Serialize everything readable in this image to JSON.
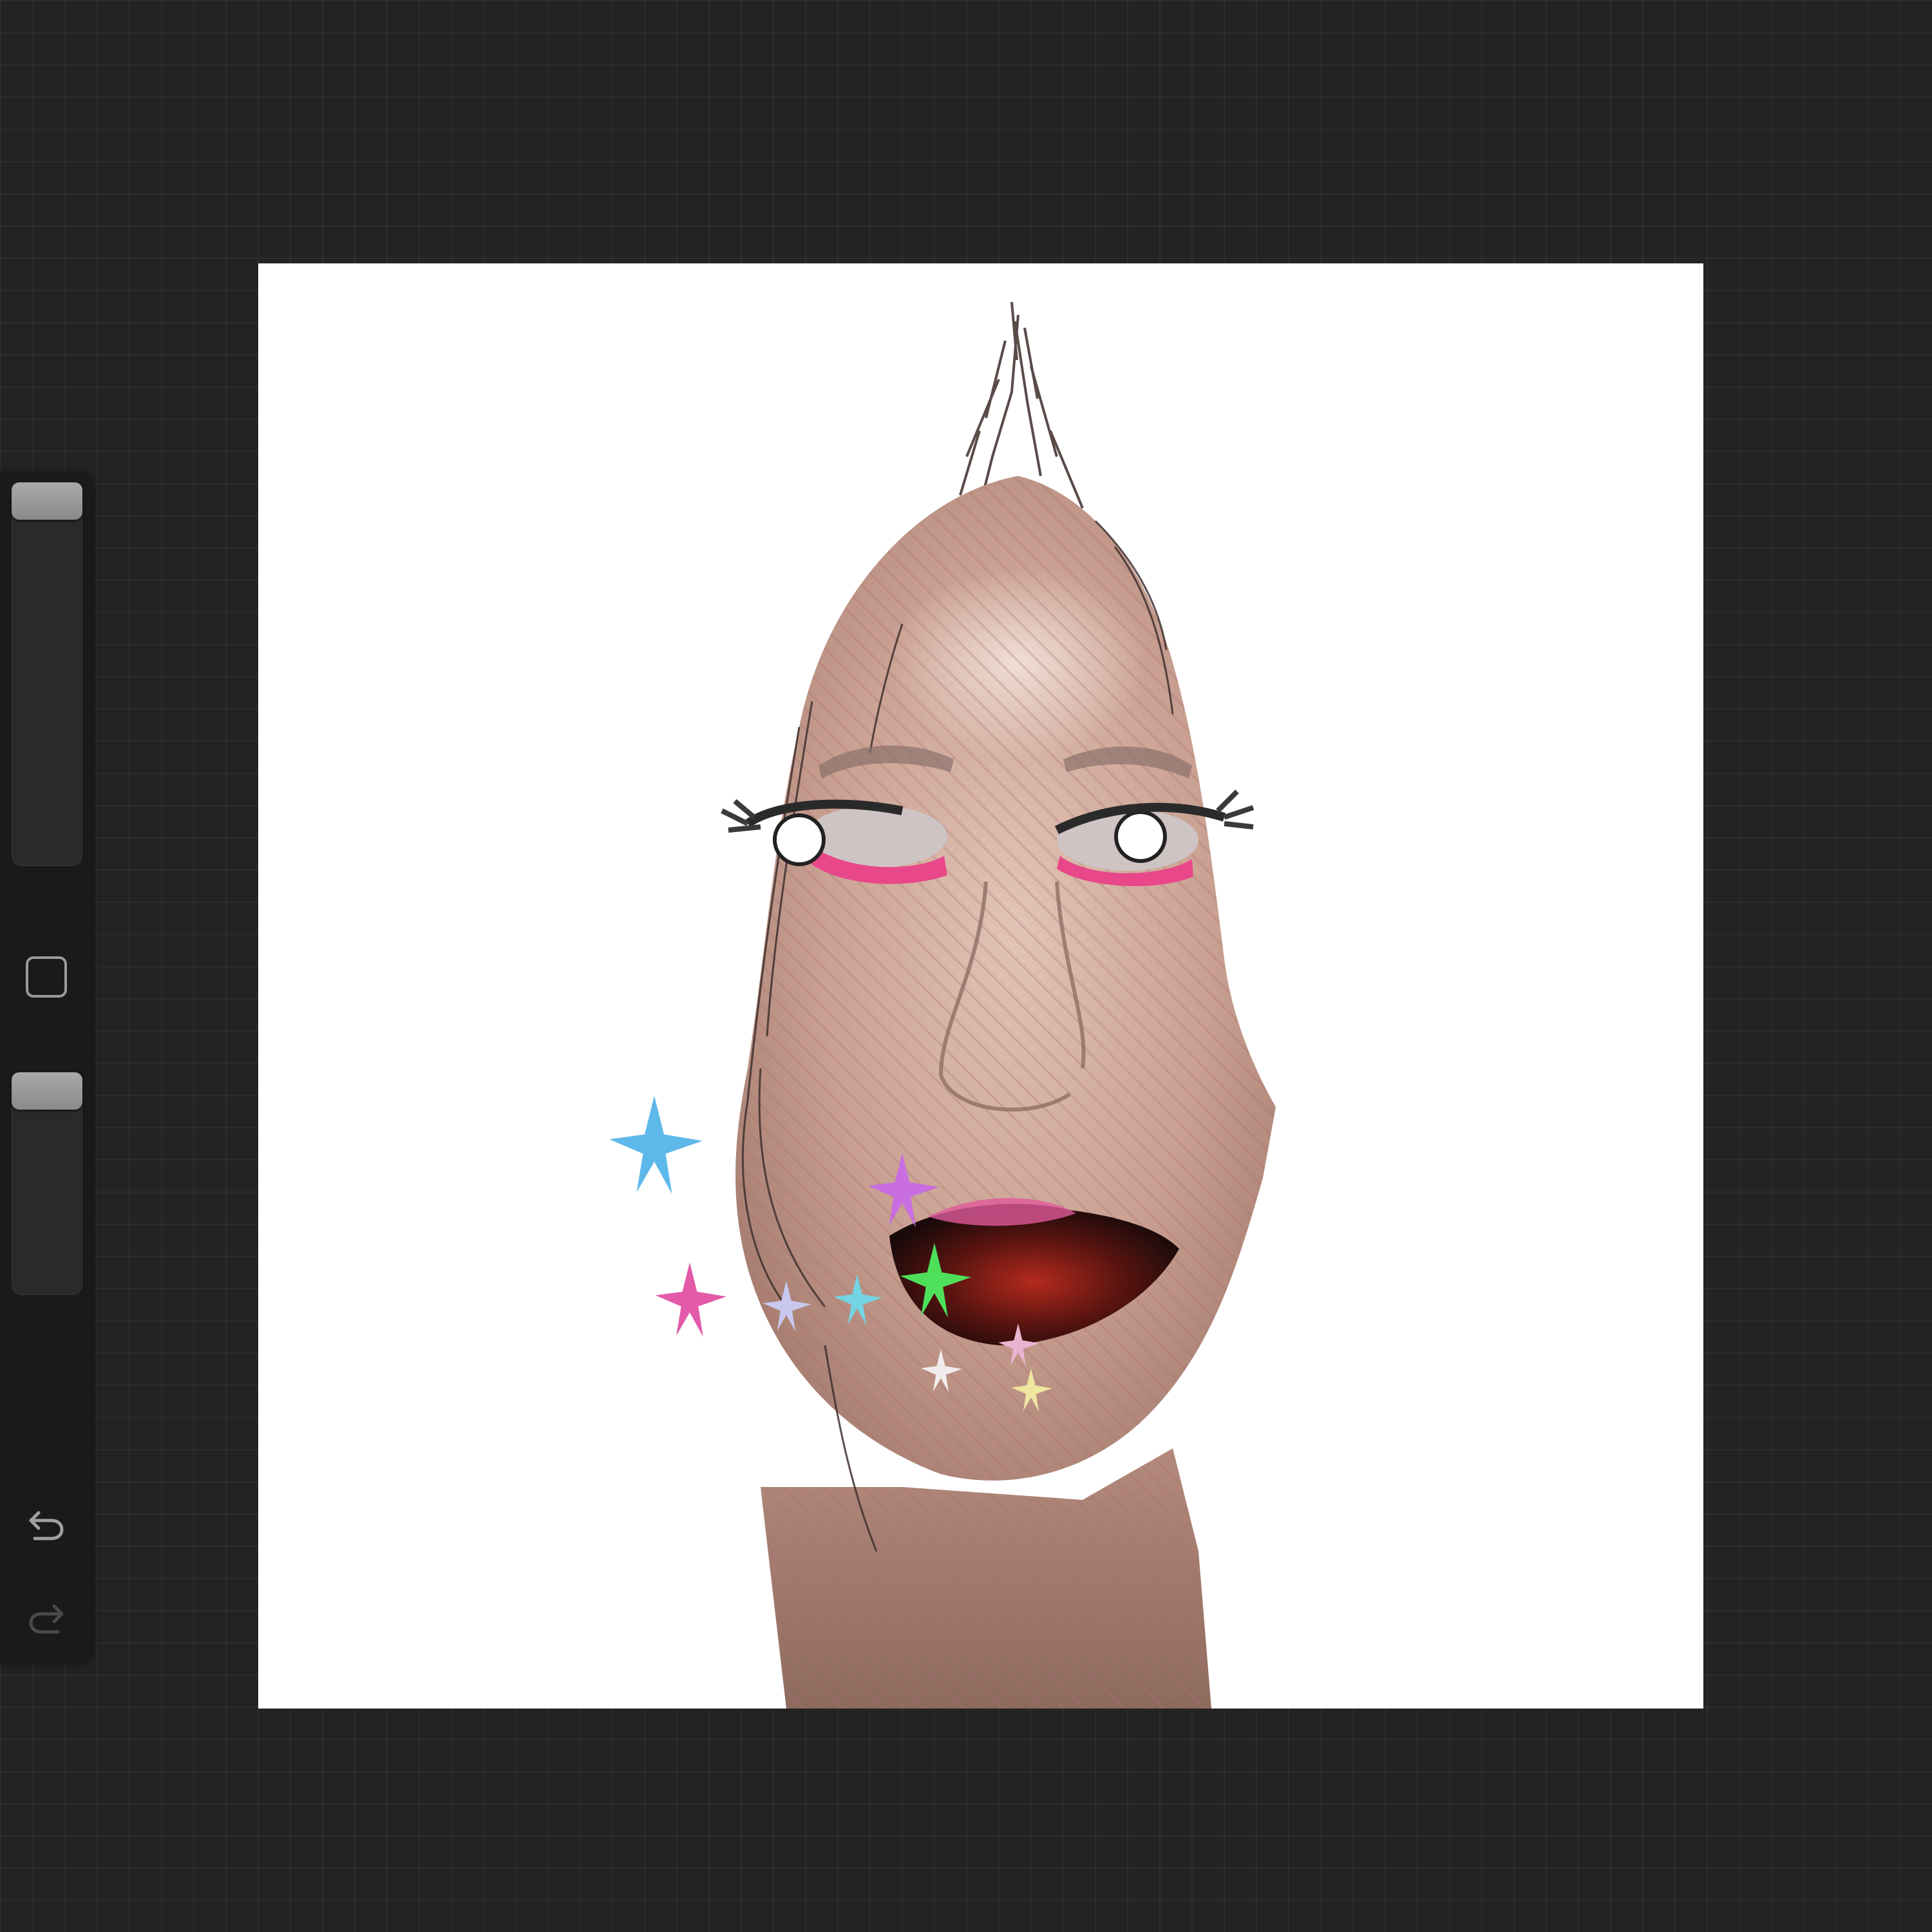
{
  "app": {
    "screen": "procreate-canvas-view"
  },
  "canvas": {
    "background": "#ffffff",
    "artwork": "digitally-edited-face-with-star-stickers",
    "stickers": [
      {
        "name": "star-sticker-blue",
        "color": "#5fb8ea"
      },
      {
        "name": "star-sticker-violet",
        "color": "#c86ee0"
      },
      {
        "name": "star-sticker-pink",
        "color": "#e25aa8"
      },
      {
        "name": "star-sticker-lavender",
        "color": "#c8c8ee"
      },
      {
        "name": "star-sticker-cyan",
        "color": "#74d4e2"
      },
      {
        "name": "star-sticker-green",
        "color": "#4ee05a"
      },
      {
        "name": "star-sticker-rose",
        "color": "#e8b4d0"
      },
      {
        "name": "star-sticker-white",
        "color": "#f2ecec"
      },
      {
        "name": "star-sticker-yellow",
        "color": "#efe6a0"
      }
    ]
  },
  "sidebar": {
    "brush_size": 1.0,
    "brush_opacity": 1.0,
    "modify_icon": "square-outline-icon",
    "undo_icon": "undo-arrow-icon",
    "redo_icon": "redo-arrow-icon",
    "redo_enabled": false
  },
  "colors": {
    "ui_background": "#232323",
    "sidebar": "#1a1a1a",
    "thumb": "#9a9a9a"
  }
}
